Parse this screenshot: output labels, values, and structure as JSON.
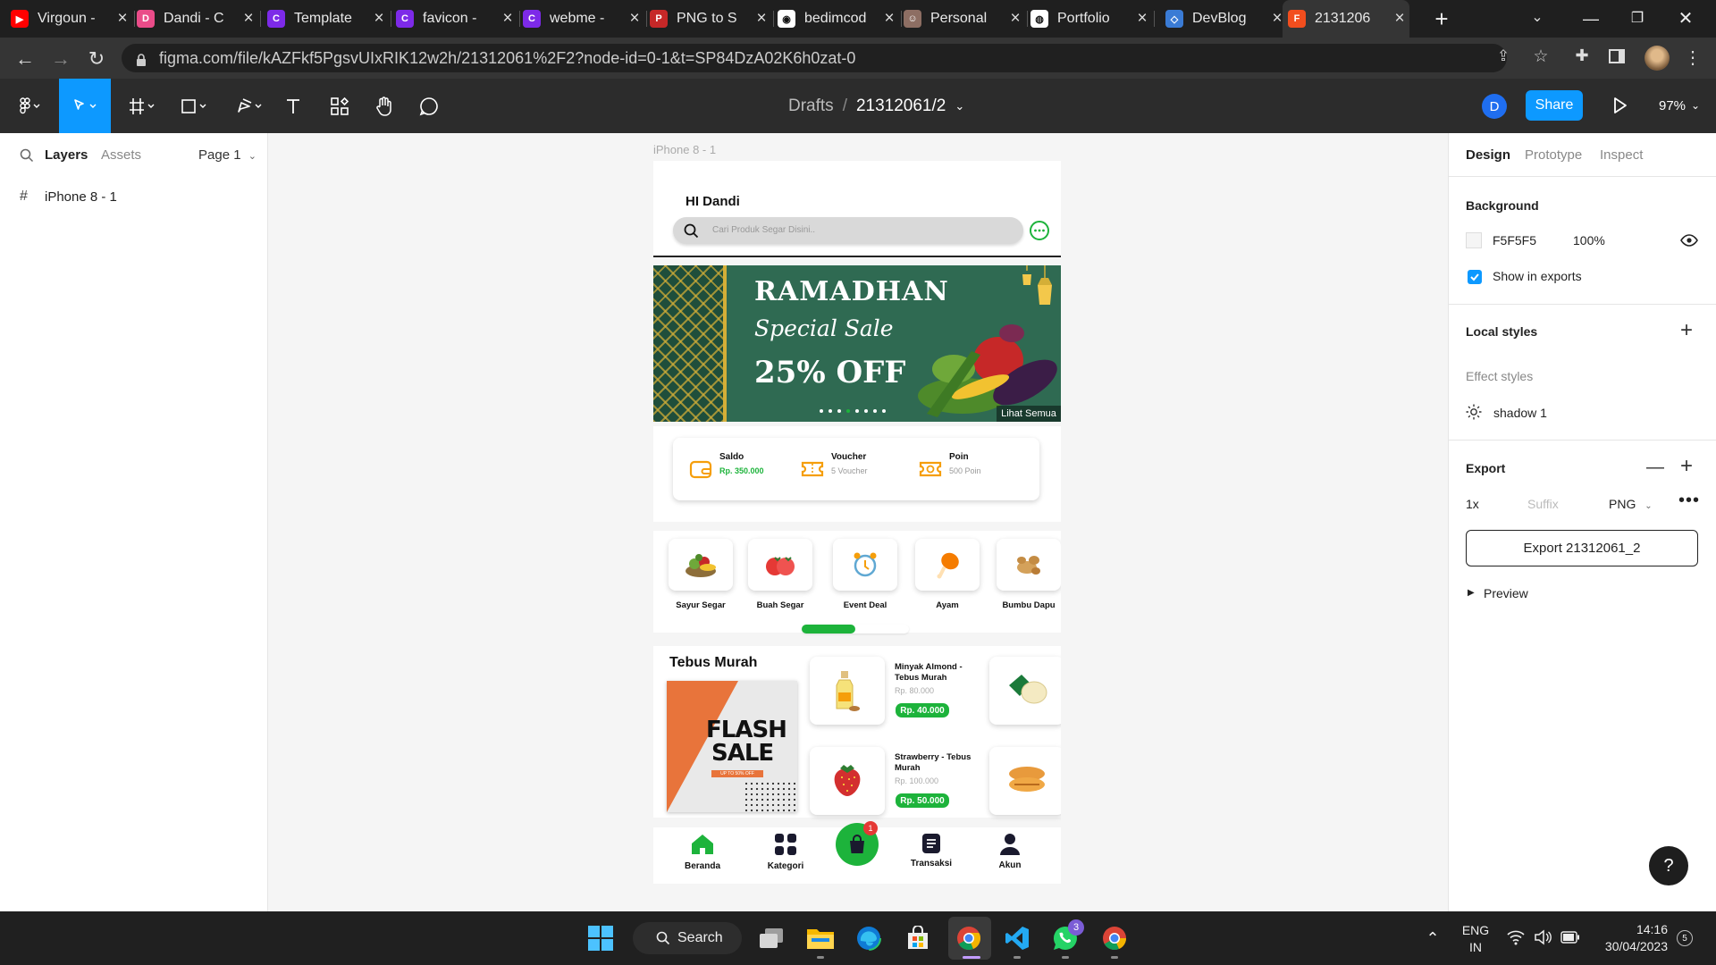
{
  "browser": {
    "tabs": [
      {
        "label": "Virgoun -",
        "icon": "youtube-icon",
        "color": "#ff0000"
      },
      {
        "label": "Dandi - C",
        "icon": "dribbble-icon",
        "color": "#ea4c89"
      },
      {
        "label": "Template",
        "icon": "canva-icon",
        "color": "#7d2ae8"
      },
      {
        "label": "favicon -",
        "icon": "canva-icon",
        "color": "#7d2ae8"
      },
      {
        "label": "webme -",
        "icon": "canva-icon",
        "color": "#7d2ae8"
      },
      {
        "label": "PNG to S",
        "icon": "png-svg-icon",
        "color": "#c62828"
      },
      {
        "label": "bedimcod",
        "icon": "github-icon",
        "color": "#ffffff"
      },
      {
        "label": "Personal",
        "icon": "profile-icon",
        "color": "#8d6e63"
      },
      {
        "label": "Portfolio",
        "icon": "globe-icon",
        "color": "#ffffff"
      },
      {
        "label": "DevBlog",
        "icon": "devblog-icon",
        "color": "#3a7bd5"
      },
      {
        "label": "2131206",
        "icon": "figma-icon",
        "color": "#f24e1e",
        "active": true
      }
    ],
    "url": "figma.com/file/kAZFkf5PgsvUIxRIK12w2h/21312061%2F2?node-id=0-1&t=SP84DzA02K6h0zat-0"
  },
  "figma": {
    "breadcrumb_project": "Drafts",
    "breadcrumb_sep": "/",
    "file_name": "21312061/2",
    "user_initial": "D",
    "share_label": "Share",
    "zoom": "97%",
    "left": {
      "tab_layers": "Layers",
      "tab_assets": "Assets",
      "page_selector": "Page 1",
      "layers": [
        {
          "label": "iPhone 8 - 1"
        }
      ]
    },
    "canvas_frame_label": "iPhone 8 - 1",
    "right": {
      "tabs": [
        "Design",
        "Prototype",
        "Inspect"
      ],
      "background_title": "Background",
      "bg_hex": "F5F5F5",
      "bg_opacity": "100%",
      "show_in_exports": "Show in exports",
      "local_styles_title": "Local styles",
      "effect_styles_title": "Effect styles",
      "effect_style": "shadow 1",
      "export_title": "Export",
      "export_scale": "1x",
      "export_suffix_placeholder": "Suffix",
      "export_format": "PNG",
      "export_button": "Export 21312061_2",
      "preview_label": "Preview",
      "help": "?"
    }
  },
  "app": {
    "greeting": "HI Dandi",
    "search_placeholder": "Cari Produk Segar Disini..",
    "banner": {
      "line1": "RAMADHAN",
      "line2": "Special Sale",
      "line3": "25% OFF",
      "see_all": "Lihat Semua"
    },
    "wallet": [
      {
        "title": "Saldo",
        "value": "Rp. 350.000",
        "icon": "wallet-icon"
      },
      {
        "title": "Voucher",
        "value": "5 Voucher",
        "icon": "ticket-icon"
      },
      {
        "title": "Poin",
        "value": "500 Poin",
        "icon": "coin-ticket-icon"
      }
    ],
    "categories": [
      {
        "label": "Sayur Segar",
        "icon": "vegetable-icon"
      },
      {
        "label": "Buah Segar",
        "icon": "tomato-icon"
      },
      {
        "label": "Event Deal",
        "icon": "alarm-clock-icon"
      },
      {
        "label": "Ayam",
        "icon": "chicken-leg-icon"
      },
      {
        "label": "Bumbu Dapu",
        "icon": "ginger-icon"
      }
    ],
    "category_scroll_fraction": 0.5,
    "flash": {
      "title": "Tebus Murah",
      "flash_line1": "FLASH",
      "flash_line2": "SALE",
      "flash_tag": "UP TO 50% OFF"
    },
    "products": [
      {
        "name": "Minyak Almond - Tebus Murah",
        "old_price": "Rp. 80.000",
        "price": "Rp. 40.000"
      },
      {
        "name": "Strawberry - Tebus Murah",
        "old_price": "Rp. 100.000",
        "price": "Rp. 50.000"
      }
    ],
    "nav": [
      {
        "label": "Beranda"
      },
      {
        "label": "Kategori"
      },
      {
        "label": "Transaksi"
      },
      {
        "label": "Akun"
      }
    ],
    "cart_badge": "1"
  },
  "taskbar": {
    "search_label": "Search",
    "whatsapp_badge": "3",
    "lang_line1": "ENG",
    "lang_line2": "IN",
    "time": "14:16",
    "date": "30/04/2023",
    "notif_count": "5"
  }
}
